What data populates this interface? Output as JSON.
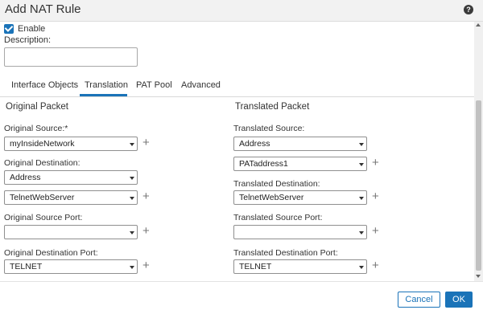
{
  "dialog": {
    "title": "Add NAT Rule",
    "help_icon": "help-circle-icon",
    "help_glyph": "?"
  },
  "general": {
    "enable_label": "Enable",
    "enable_checked": true,
    "description_label": "Description:",
    "description_value": ""
  },
  "tabs": [
    {
      "label": "Interface Objects",
      "active": false
    },
    {
      "label": "Translation",
      "active": true
    },
    {
      "label": "PAT Pool",
      "active": false
    },
    {
      "label": "Advanced",
      "active": false
    }
  ],
  "original": {
    "title": "Original Packet",
    "source_label": "Original Source:*",
    "source_value": "myInsideNetwork",
    "destination_label": "Original Destination:",
    "destination_type": "Address",
    "destination_value": "TelnetWebServer",
    "source_port_label": "Original Source Port:",
    "source_port_value": "",
    "destination_port_label": "Original Destination Port:",
    "destination_port_value": "TELNET"
  },
  "translated": {
    "title": "Translated Packet",
    "source_label": "Translated Source:",
    "source_type": "Address",
    "source_value": "PATaddress1",
    "destination_label": "Translated Destination:",
    "destination_value": "TelnetWebServer",
    "source_port_label": "Translated Source Port:",
    "source_port_value": "",
    "destination_port_label": "Translated Destination Port:",
    "destination_port_value": "TELNET"
  },
  "icons": {
    "add_glyph": "+"
  },
  "footer": {
    "cancel_label": "Cancel",
    "ok_label": "OK"
  },
  "colors": {
    "accent": "#1a73b8",
    "title_bar": "#f2f2f2"
  }
}
